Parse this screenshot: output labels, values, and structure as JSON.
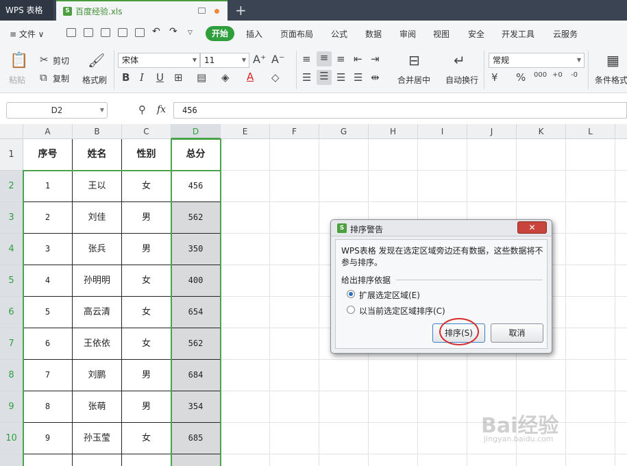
{
  "titlebar": {
    "app_name": "WPS 表格",
    "file_name": "百度经验.xls",
    "file_icon": "S",
    "new_tab": "+"
  },
  "menu": {
    "file": "≡ 文件 ∨",
    "items": [
      "开始",
      "插入",
      "页面布局",
      "公式",
      "数据",
      "审阅",
      "视图",
      "安全",
      "开发工具",
      "云服务"
    ],
    "active": "开始"
  },
  "ribbon": {
    "paste": "粘贴",
    "cut": "剪切",
    "copy": "复制",
    "format_painter": "格式刷",
    "font_name": "宋体",
    "font_size": "11",
    "merge": "合并居中",
    "wrap": "自动换行",
    "number_format": "常规",
    "cond_format": "条件格式",
    "bold": "B",
    "italic": "I",
    "underline": "U"
  },
  "formula_bar": {
    "name_box": "D2",
    "fx": "fx",
    "value": "456"
  },
  "columns": [
    "A",
    "B",
    "C",
    "D",
    "E",
    "F",
    "G",
    "H",
    "I",
    "J",
    "K",
    "L"
  ],
  "rows": [
    "1",
    "2",
    "3",
    "4",
    "5",
    "6",
    "7",
    "8",
    "9",
    "10"
  ],
  "table": {
    "headers": [
      "序号",
      "姓名",
      "性别",
      "总分"
    ],
    "data": [
      [
        "1",
        "王以",
        "女",
        "456"
      ],
      [
        "2",
        "刘佳",
        "男",
        "562"
      ],
      [
        "3",
        "张兵",
        "男",
        "350"
      ],
      [
        "4",
        "孙明明",
        "女",
        "400"
      ],
      [
        "5",
        "高云清",
        "女",
        "654"
      ],
      [
        "6",
        "王依依",
        "女",
        "562"
      ],
      [
        "7",
        "刘鹏",
        "男",
        "684"
      ],
      [
        "8",
        "张萌",
        "男",
        "354"
      ],
      [
        "9",
        "孙玉莹",
        "女",
        "685"
      ]
    ]
  },
  "dialog": {
    "icon": "S",
    "title": "排序警告",
    "close": "✕",
    "message": "WPS表格 发现在选定区域旁边还有数据，这些数据将不参与排序。",
    "group_label": "给出排序依据",
    "option_expand": "扩展选定区域(E)",
    "option_current": "以当前选定区域排序(C)",
    "selected_option": "expand",
    "sort_button": "排序(S)",
    "cancel_button": "取消"
  },
  "watermark": {
    "brand": "Bai经验",
    "url": "jingyan.baidu.com"
  },
  "colors": {
    "accent": "#2f9f3e",
    "selection": "#4aa34a",
    "close": "#c9443a",
    "highlight_circle": "#d62a2a"
  }
}
